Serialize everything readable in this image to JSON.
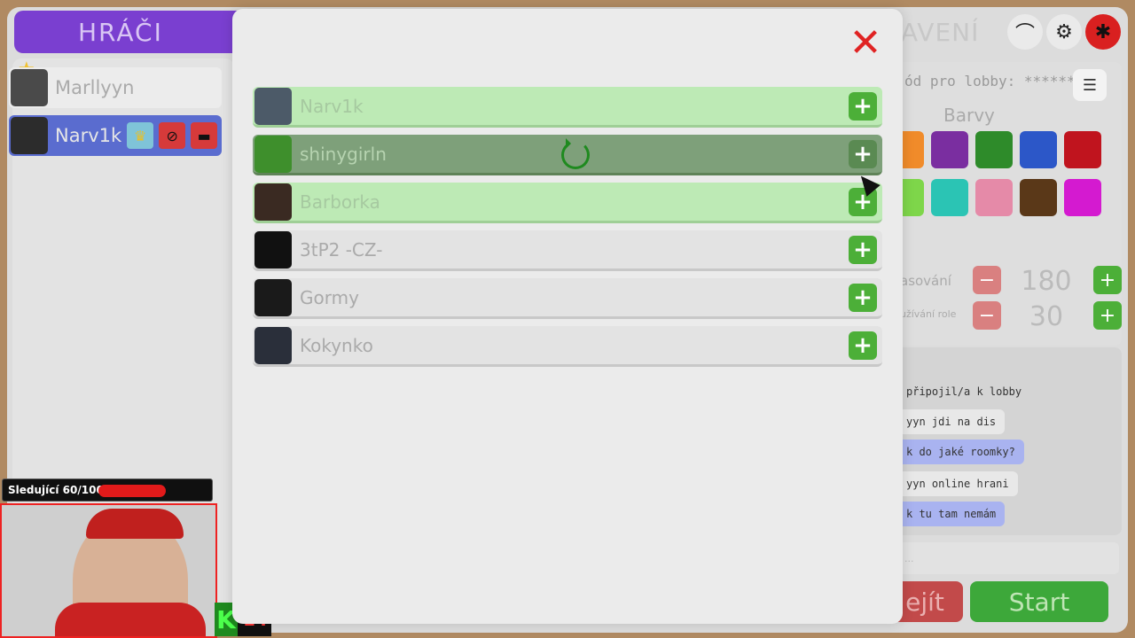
{
  "players": {
    "header": "HRÁČI",
    "list": [
      {
        "name": "Marllyyn"
      },
      {
        "name": "Narv1k"
      }
    ]
  },
  "settings": {
    "header": "TAVENÍ",
    "lobby_code": "ód pro lobby: ******",
    "colors_title": "Barvy",
    "colors": [
      "#f08b2a",
      "#7a2ea0",
      "#2e8b2a",
      "#2c57c8",
      "#c0141e",
      "#7ed64a",
      "#2bc4b4",
      "#e58aa8",
      "#5a3818",
      "#d41ad0"
    ],
    "timer_label": "asování",
    "timer_value": "180",
    "role_label": "užívání role",
    "role_value": "30"
  },
  "chat": {
    "messages": [
      {
        "text": "připojil/a k lobby",
        "style": "system"
      },
      {
        "text": "yyn jdi na dis",
        "style": "me"
      },
      {
        "text": "k do jaké roomky?",
        "style": "other"
      },
      {
        "text": "yyn online hrani",
        "style": "me"
      },
      {
        "text": "k tu tam nemám",
        "style": "other"
      }
    ],
    "input_placeholder": "..."
  },
  "buttons": {
    "leave": "ejít",
    "start": "Start"
  },
  "stream": {
    "followers": "Sledující 60/100",
    "followers_progress": 0.6,
    "counter_letter": "K",
    "counter_value": "14"
  },
  "modal": {
    "friends": [
      {
        "name": "Narv1k",
        "state": "green"
      },
      {
        "name": "shinygirln",
        "state": "dark"
      },
      {
        "name": "Barborka",
        "state": "green"
      },
      {
        "name": "3tP2 -CZ-",
        "state": "grey"
      },
      {
        "name": "Gormy",
        "state": "grey"
      },
      {
        "name": "Kokynko",
        "state": "grey"
      }
    ]
  }
}
